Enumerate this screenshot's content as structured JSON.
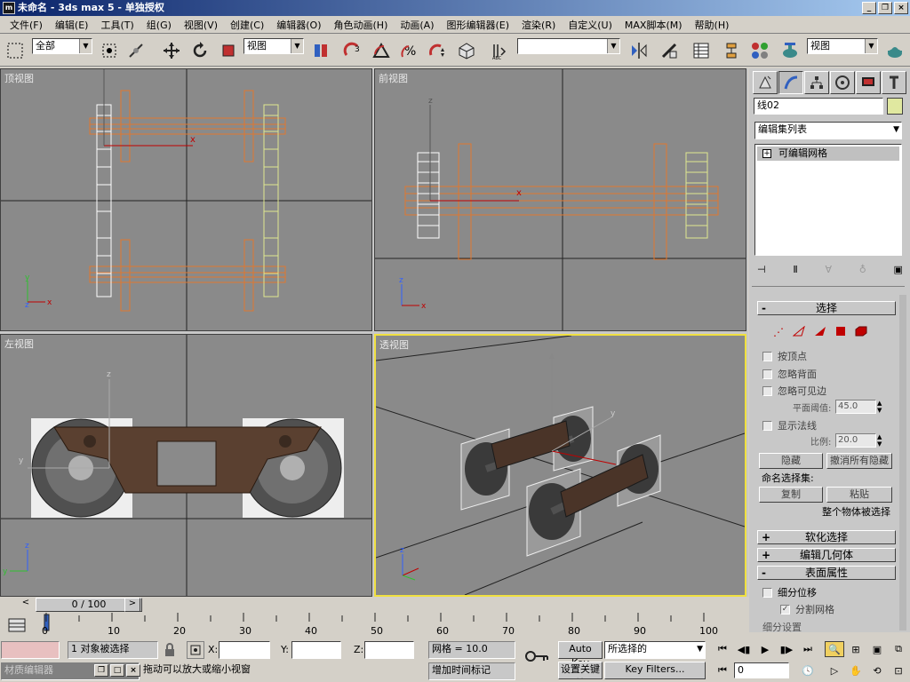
{
  "window": {
    "title": "未命名 - 3ds max 5 - 单独授权",
    "icon_text": "m",
    "controls": [
      "_",
      "❐",
      "×"
    ]
  },
  "menu": [
    "文件(F)",
    "编辑(E)",
    "工具(T)",
    "组(G)",
    "视图(V)",
    "创建(C)",
    "编辑器(O)",
    "角色动画(H)",
    "动画(A)",
    "图形编辑器(E)",
    "渲染(R)",
    "自定义(U)",
    "MAX脚本(M)",
    "帮助(H)"
  ],
  "toolbar": {
    "selection_filter": "全部",
    "ref_coord": "视图",
    "named_selection": "",
    "render_view": "视图"
  },
  "viewports": {
    "top": "顶视图",
    "front": "前视图",
    "left": "左视图",
    "perspective": "透视图"
  },
  "command_panel": {
    "object_name": "线02",
    "object_color": "#e0e8a0",
    "modifier_list": "编辑集列表",
    "stack_item": "可编辑网格",
    "stack_expand": "+",
    "rollout_select": {
      "title": "选择",
      "by_vertex": "按顶点",
      "ignore_backface": "忽略背面",
      "ignore_visible_edges": "忽略可见边",
      "planar_threshold_label": "平面阈值",
      "planar_threshold": "45.0",
      "show_normals": "显示法线",
      "scale_label": "比例",
      "scale": "20.0",
      "hide": "隐藏",
      "unhide_all": "撤消所有隐藏",
      "named_sets": "命名选择集:",
      "copy": "复制",
      "paste": "粘贴",
      "whole_object": "整个物体被选择"
    },
    "rollout_soft": "软化选择",
    "rollout_geom": "编辑几何体",
    "rollout_surface": "表面属性",
    "subdiv_disp": "细分位移",
    "split_mesh": "分割网格",
    "subdiv_preset": "细分设置"
  },
  "timeline": {
    "slider": "0 / 100",
    "ticks": [
      "0",
      "10",
      "20",
      "30",
      "40",
      "50",
      "60",
      "70",
      "80",
      "90",
      "100"
    ]
  },
  "status": {
    "selected": "1 对象被选择",
    "x_label": "X:",
    "y_label": "Y:",
    "z_label": "Z:",
    "grid": "网格 = 10.0",
    "auto_key": "Auto Key",
    "set_key": "设置关键帧",
    "selected_dropdown": "所选择的",
    "key_filters": "Key Filters...",
    "hint": "拖动可以放大或缩小视窗",
    "add_time_tag": "增加时间标记",
    "frame": "0",
    "mat_editor": "材质编辑器"
  }
}
